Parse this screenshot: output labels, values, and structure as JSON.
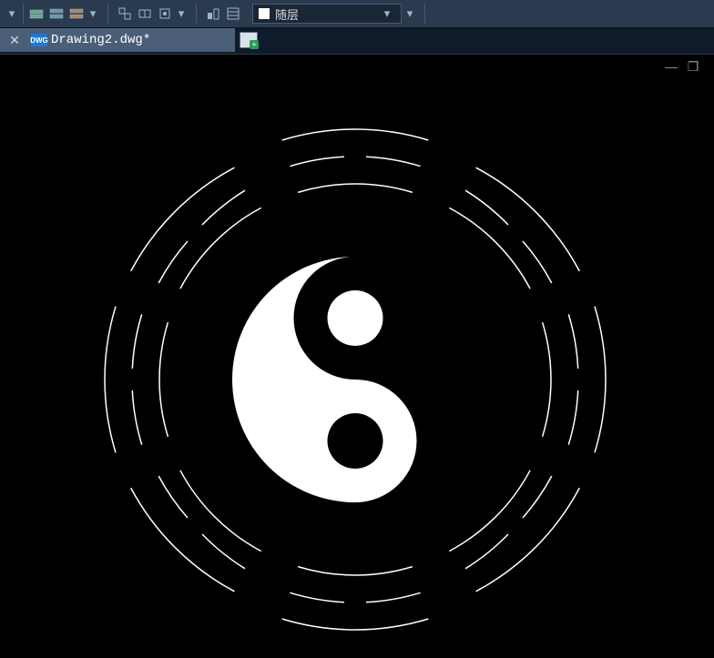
{
  "tab": {
    "label": "Drawing2.dwg*",
    "icon_text": "DWG"
  },
  "layer": {
    "name": "随层"
  },
  "window_controls": {
    "min": "—",
    "restore": "❐",
    "close": ""
  }
}
